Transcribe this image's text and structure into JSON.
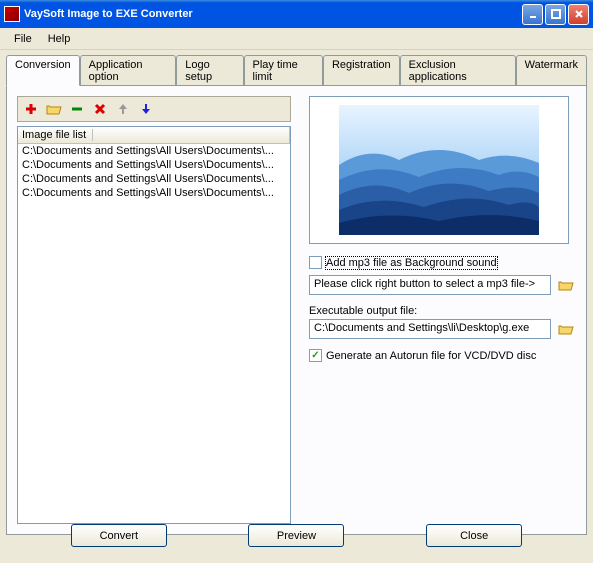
{
  "window": {
    "title": "VaySoft Image to EXE Converter"
  },
  "menu": {
    "file": "File",
    "help": "Help"
  },
  "tabs": {
    "items": [
      "Conversion",
      "Application option",
      "Logo setup",
      "Play time limit",
      "Registration",
      "Exclusion applications",
      "Watermark"
    ]
  },
  "toolbar": {
    "add": "+",
    "open": "📂",
    "remove": "−",
    "delete": "✖",
    "up": "↑",
    "down": "↓"
  },
  "list": {
    "header": "Image file list",
    "items": [
      "C:\\Documents and Settings\\All Users\\Documents\\...",
      "C:\\Documents and Settings\\All Users\\Documents\\...",
      "C:\\Documents and Settings\\All Users\\Documents\\...",
      "C:\\Documents and Settings\\All Users\\Documents\\..."
    ]
  },
  "options": {
    "mp3_checkbox": "Add mp3 file as Background sound",
    "mp3_placeholder": "Please click right button to select a mp3 file->",
    "output_label": "Executable output file:",
    "output_value": "C:\\Documents and Settings\\li\\Desktop\\g.exe",
    "autorun_label": "Generate an Autorun file for VCD/DVD disc"
  },
  "buttons": {
    "convert": "Convert",
    "preview": "Preview",
    "close": "Close"
  }
}
